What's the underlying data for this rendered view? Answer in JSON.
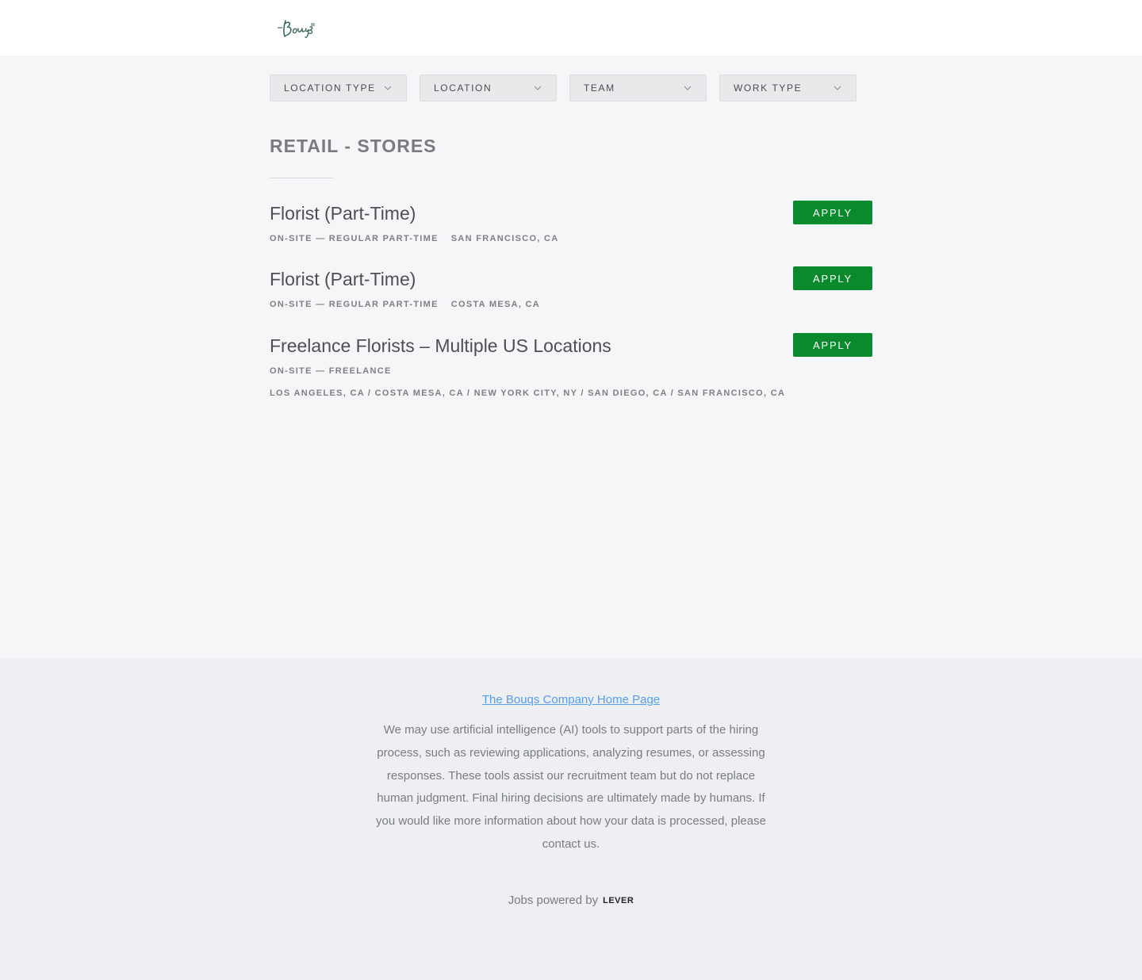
{
  "header": {
    "logo_icon": "bouqs-logo-icon"
  },
  "filters": [
    {
      "label": "LOCATION TYPE"
    },
    {
      "label": "LOCATION"
    },
    {
      "label": "TEAM"
    },
    {
      "label": "WORK TYPE"
    }
  ],
  "team": {
    "title": "RETAIL - STORES"
  },
  "postings": [
    {
      "title": "Florist (Part-Time)",
      "work_type": "ON-SITE — REGULAR PART-TIME",
      "location": "SAN FRANCISCO, CA",
      "apply_label": "APPLY"
    },
    {
      "title": "Florist (Part-Time)",
      "work_type": "ON-SITE — REGULAR PART-TIME",
      "location": "COSTA MESA, CA",
      "apply_label": "APPLY"
    },
    {
      "title": "Freelance Florists – Multiple US Locations",
      "work_type": "ON-SITE — FREELANCE",
      "location": "LOS ANGELES, CA / COSTA MESA, CA / NEW YORK CITY, NY / SAN DIEGO, CA / SAN FRANCISCO, CA",
      "apply_label": "APPLY"
    }
  ],
  "footer": {
    "home_link": "The Bouqs Company Home Page",
    "ai_notice": "We may use artificial intelligence (AI) tools to support parts of the hiring process, such as reviewing applications, analyzing resumes, or assessing responses. These tools assist our recruitment team but do not replace human judgment. Final hiring decisions are ultimately made by humans. If you would like more information about how your data is processed, please contact us.",
    "powered_by": "Jobs powered by",
    "powered_brand": "LEVER"
  },
  "colors": {
    "apply": "#0a8a2d",
    "link": "#579eee",
    "logo": "#3d6b58"
  }
}
